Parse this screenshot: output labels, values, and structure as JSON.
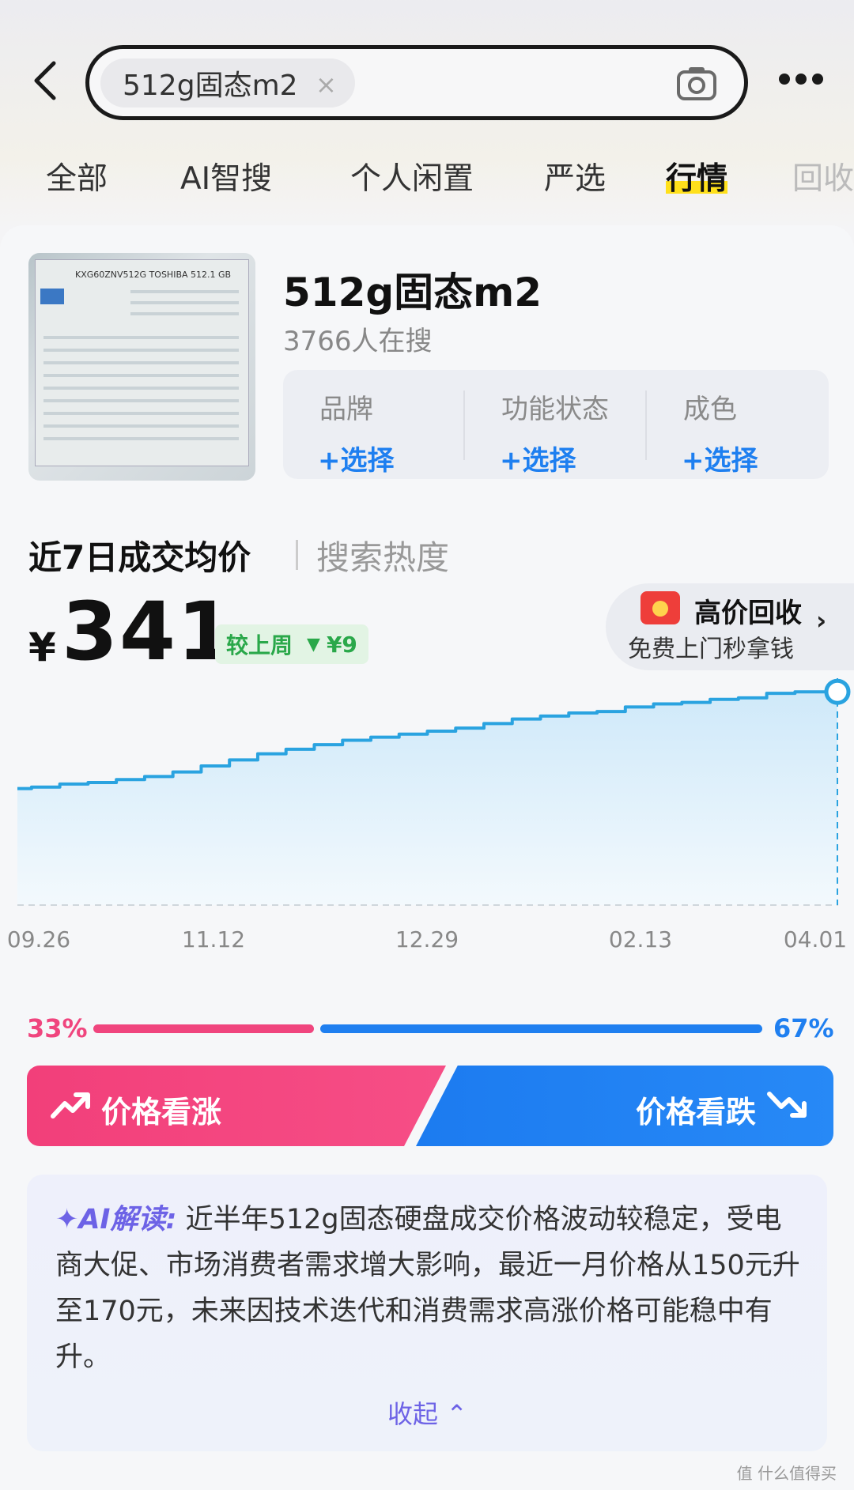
{
  "search": {
    "query": "512g固态m2",
    "clear_icon": "close-icon",
    "camera_icon": "camera-icon"
  },
  "tabs": [
    {
      "label": "全部"
    },
    {
      "label": "AI智搜"
    },
    {
      "label": "个人闲置"
    },
    {
      "label": "严选"
    },
    {
      "label": "行情",
      "active": true
    },
    {
      "label": "回收"
    }
  ],
  "product": {
    "title": "512g固态m2",
    "searchers": "3766人在搜",
    "thumb_caption": "KXG60ZNV512G TOSHIBA 512.1 GB"
  },
  "filters": [
    {
      "label": "品牌",
      "action": "+选择"
    },
    {
      "label": "功能状态",
      "action": "+选择"
    },
    {
      "label": "成色",
      "action": "+选择"
    }
  ],
  "price_tabs": {
    "active": "近7日成交均价",
    "inactive": "搜索热度"
  },
  "price": {
    "currency": "¥",
    "value": "341",
    "compare_label": "较上周",
    "compare_value": "¥9",
    "compare_direction": "down"
  },
  "recycle": {
    "title": "高价回收",
    "subtitle": "免费上门秒拿钱"
  },
  "chart_data": {
    "type": "area",
    "x_ticks": [
      "09.26",
      "11.12",
      "12.29",
      "02.13",
      "04.01"
    ],
    "values": [
      277,
      278,
      280,
      281,
      283,
      285,
      288,
      292,
      296,
      300,
      303,
      306,
      309,
      311,
      313,
      315,
      317,
      320,
      323,
      325,
      327,
      328,
      331,
      333,
      334,
      336,
      337,
      340,
      341,
      341
    ],
    "ylim": [
      200,
      350
    ],
    "color": "#2aa3e0",
    "fill": "#d6edfa",
    "grid": false
  },
  "sentiment": {
    "up_pct": "33%",
    "down_pct": "67%",
    "up_fraction": 0.33,
    "up_label": "价格看涨",
    "down_label": "价格看跌",
    "up_color": "#f0457e",
    "down_color": "#1f7ff0"
  },
  "ai": {
    "label": "AI解读:",
    "text": "近半年512g固态硬盘成交价格波动较稳定，受电商大促、市场消费者需求增大影响，最近一月价格从150元升至170元，未来因技术迭代和消费需求高涨价格可能稳中有升。",
    "collapse": "收起"
  },
  "watermark": "值 什么值得买"
}
